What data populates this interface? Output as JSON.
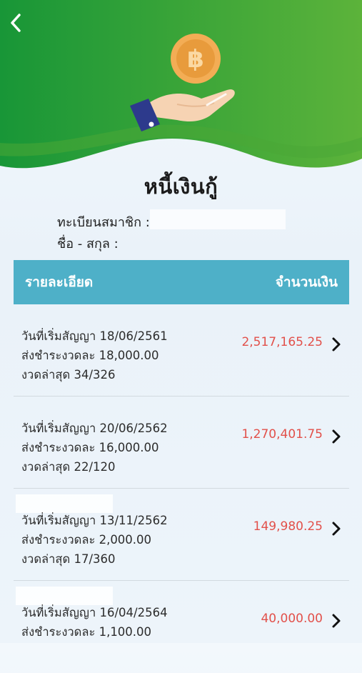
{
  "header": {
    "back_icon": "chevron-left-icon",
    "illustration_icon": "bitcoin-coin-hand-icon",
    "coin_symbol": "฿",
    "colors": {
      "green_dark": "#1c9a3a",
      "green_light": "#6ab83a",
      "coin": "#f0a64a"
    }
  },
  "page": {
    "title": "หนี้เงินกู้"
  },
  "member": {
    "id_label": "ทะเบียนสมาชิก :",
    "name_label": "ชื่อ - สกุล :"
  },
  "table": {
    "col_detail": "รายละเอียด",
    "col_amount": "จำนวนเงิน",
    "header_color": "#4eb0c8"
  },
  "loans": [
    {
      "start": "วันที่เริ่มสัญญา 18/06/2561",
      "installment": "ส่งชำระงวดละ 18,000.00",
      "latest": "งวดล่าสุด 34/326",
      "amount": "2,517,165.25"
    },
    {
      "start": "วันที่เริ่มสัญญา 20/06/2562",
      "installment": "ส่งชำระงวดละ 16,000.00",
      "latest": "งวดล่าสุด 22/120",
      "amount": "1,270,401.75"
    },
    {
      "start": "วันที่เริ่มสัญญา 13/11/2562",
      "installment": "ส่งชำระงวดละ 2,000.00",
      "latest": "งวดล่าสุด 17/360",
      "amount": "149,980.25"
    },
    {
      "start": "วันที่เริ่มสัญญา 16/04/2564",
      "installment": "ส่งชำระงวดละ 1,100.00",
      "latest": "",
      "amount": "40,000.00"
    }
  ]
}
